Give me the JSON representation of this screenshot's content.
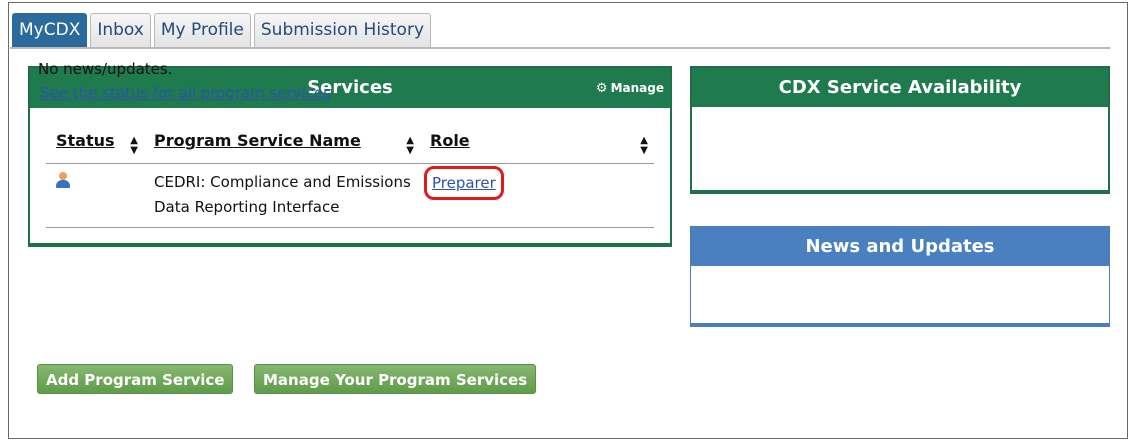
{
  "tabs": [
    {
      "label": "MyCDX",
      "active": true
    },
    {
      "label": "Inbox",
      "active": false
    },
    {
      "label": "My Profile",
      "active": false
    },
    {
      "label": "Submission History",
      "active": false
    }
  ],
  "services": {
    "title": "Services",
    "manage_label": "Manage",
    "columns": [
      "Status",
      "Program Service Name",
      "Role"
    ],
    "rows": [
      {
        "status_icon": "user-icon",
        "name_line1": "CEDRI: Compliance and Emissions",
        "name_line2": "Data Reporting Interface",
        "role": "Preparer"
      }
    ]
  },
  "availability": {
    "title": "CDX Service Availability",
    "link": "See the status for all program services"
  },
  "news": {
    "title": "News and Updates",
    "text": "No news/updates."
  },
  "buttons": {
    "add": "Add Program Service",
    "manage": "Manage Your Program Services"
  },
  "colors": {
    "service_header": "#1f7a4d",
    "news_header": "#4a80c0",
    "button_green": "#5f9c4a",
    "highlight": "#e01b1b"
  }
}
